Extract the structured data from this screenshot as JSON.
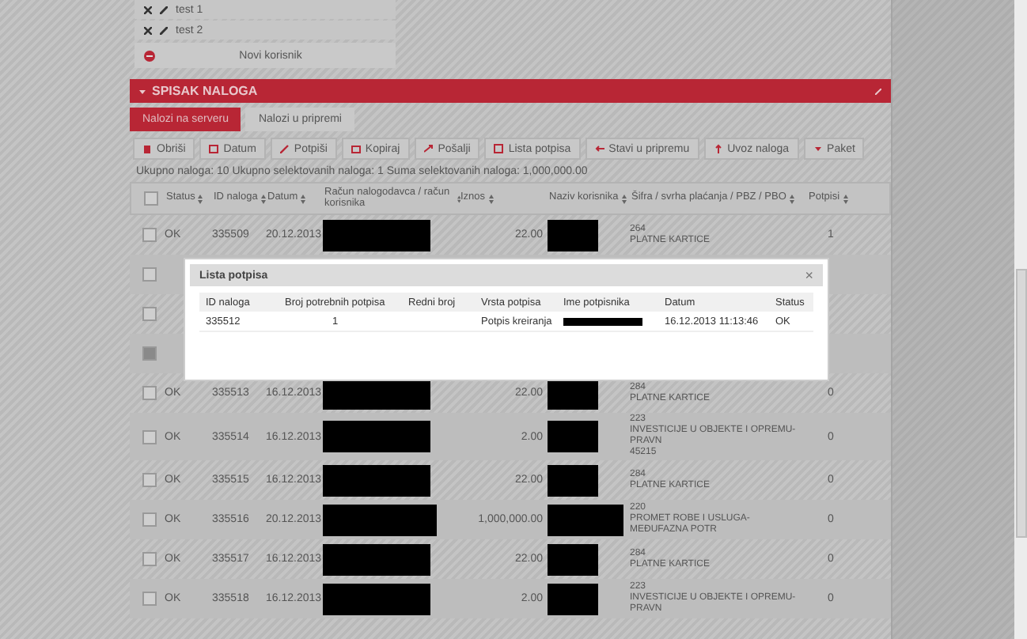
{
  "users": [
    {
      "name": "test 1"
    },
    {
      "name": "test 2"
    }
  ],
  "new_user_button": "Novi korisnik",
  "panel": {
    "title": "SPISAK NALOGA",
    "expanded": true
  },
  "tabs": [
    {
      "label": "Nalozi na serveru",
      "selected": true
    },
    {
      "label": "Nalozi u pripremi",
      "selected": false
    }
  ],
  "toolbar": [
    {
      "label": "Obriši"
    },
    {
      "label": "Datum"
    },
    {
      "label": "Potpiši"
    },
    {
      "label": "Kopiraj"
    },
    {
      "label": "Pošalji"
    },
    {
      "label": "Lista potpisa"
    },
    {
      "label": "Stavi u pripremu"
    },
    {
      "label": "Uvoz naloga"
    },
    {
      "label": "Paket"
    }
  ],
  "summary": "Ukupno naloga: 10 Ukupno selektovanih naloga: 1 Suma selektovanih naloga: 1,000,000.00",
  "table": {
    "select_all_checked": false,
    "columns": [
      "Status",
      "ID naloga",
      "Datum",
      "Račun nalogodavca / račun korisnika",
      "Iznos",
      "Naziv korisnika",
      "Šifra / svrha plaćanja / PBZ / PBO",
      "Potpisi"
    ],
    "rows": [
      {
        "kind": "full",
        "checked": false,
        "status": "OK",
        "id": "335509",
        "date": "20.12.2013",
        "amount": "22.00",
        "code": [
          "264",
          "PLATNE KARTICE"
        ],
        "signatures": "1"
      },
      {
        "kind": "covered",
        "checked": false
      },
      {
        "kind": "covered",
        "checked": false
      },
      {
        "kind": "covered",
        "checked": true
      },
      {
        "kind": "full",
        "checked": false,
        "status": "OK",
        "id": "335513",
        "date": "16.12.2013",
        "amount": "22.00",
        "code": [
          "284",
          "PLATNE KARTICE"
        ],
        "signatures": "0"
      },
      {
        "kind": "full",
        "checked": false,
        "status": "OK",
        "id": "335514",
        "date": "16.12.2013",
        "amount": "2.00",
        "code": [
          "223",
          "INVESTICIJE U OBJEKTE I OPREMU-",
          "PRAVN",
          "45215"
        ],
        "signatures": "0"
      },
      {
        "kind": "full",
        "checked": false,
        "status": "OK",
        "id": "335515",
        "date": "16.12.2013",
        "amount": "22.00",
        "code": [
          "284",
          "PLATNE KARTICE"
        ],
        "signatures": "0"
      },
      {
        "kind": "full",
        "checked": false,
        "status": "OK",
        "id": "335516",
        "date": "20.12.2013",
        "amount": "1,000,000.00",
        "code": [
          "220",
          "PROMET ROBE I USLUGA-",
          "MEĐUFAZNA POTR"
        ],
        "signatures": "0"
      },
      {
        "kind": "full",
        "checked": false,
        "status": "OK",
        "id": "335517",
        "date": "16.12.2013",
        "amount": "22.00",
        "code": [
          "284",
          "PLATNE KARTICE"
        ],
        "signatures": "0"
      },
      {
        "kind": "full",
        "checked": false,
        "status": "OK",
        "id": "335518",
        "date": "16.12.2013",
        "amount": "2.00",
        "code": [
          "223",
          "INVESTICIJE U OBJEKTE I OPREMU-",
          "PRAVN"
        ],
        "signatures": "0"
      }
    ]
  },
  "dialog": {
    "title": "Lista potpisa",
    "close": "×",
    "columns": [
      "ID naloga",
      "Broj potrebnih potpisa",
      "Redni broj",
      "Vrsta potpisa",
      "Ime potpisnika",
      "Datum",
      "Status"
    ],
    "rows": [
      {
        "id": "335512",
        "required": "1",
        "type": "Potpis kreiranja",
        "date": "16.12.2013 11:13:46",
        "status": "OK"
      }
    ]
  }
}
